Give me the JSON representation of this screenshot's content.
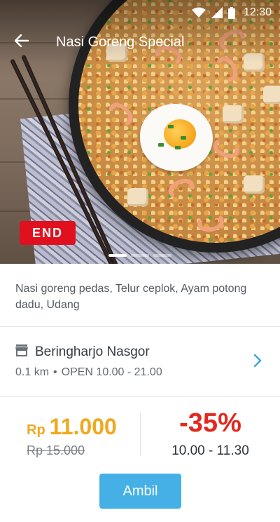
{
  "status_bar": {
    "time": "12:30",
    "icons": [
      "wifi-icon",
      "cell-signal-icon",
      "battery-icon"
    ]
  },
  "app_bar": {
    "title": "Nasi Goreng Special",
    "back_icon": "arrow-left-icon"
  },
  "hero": {
    "badge": "END",
    "carousel": {
      "pages": 3,
      "active": 1
    }
  },
  "description": "Nasi goreng pedas, Telur ceplok, Ayam potong dadu, Udang",
  "store": {
    "icon": "store-icon",
    "name": "Beringharjo Nasgor",
    "distance": "0.1 km",
    "separator": "•",
    "hours_label": "OPEN 10.00 - 21.00",
    "chevron_icon": "chevron-right-icon"
  },
  "pricing": {
    "currency": "Rp",
    "price": "11.000",
    "original_price": "Rp 15.000",
    "discount": "-35%",
    "promo_hours": "10.00 - 11.30"
  },
  "action": {
    "label": "Ambil"
  },
  "colors": {
    "price": "#f0a820",
    "discount": "#e02a1f",
    "badge": "#e0101e",
    "button": "#45b0e6",
    "chevron": "#3aa6df"
  }
}
